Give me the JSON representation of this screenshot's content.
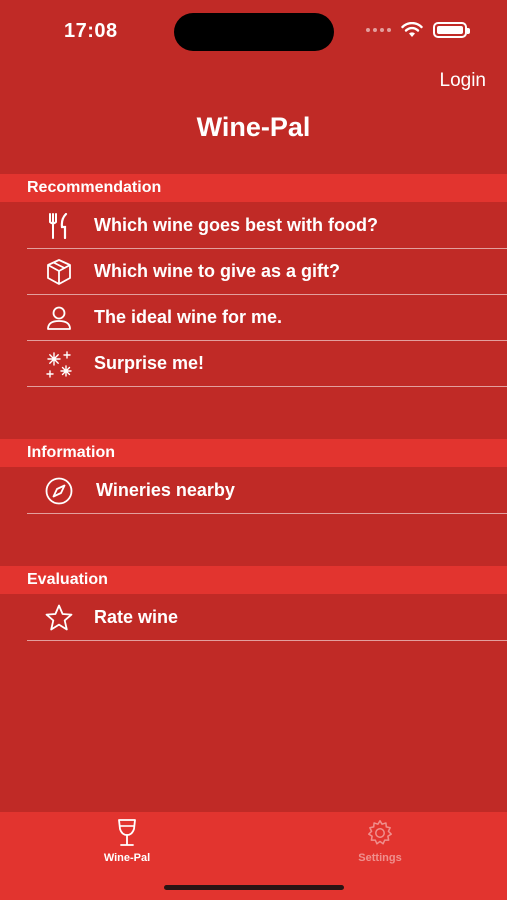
{
  "status_bar": {
    "time": "17:08"
  },
  "header": {
    "login_label": "Login",
    "title": "Wine-Pal"
  },
  "sections": {
    "recommendation": {
      "title": "Recommendation",
      "items": [
        {
          "label": "Which wine goes best with food?",
          "icon": "fork-knife-icon"
        },
        {
          "label": "Which wine to give as a gift?",
          "icon": "gift-box-icon"
        },
        {
          "label": "The ideal wine for me.",
          "icon": "person-icon"
        },
        {
          "label": "Surprise me!",
          "icon": "sparkler-icon"
        }
      ]
    },
    "information": {
      "title": "Information",
      "items": [
        {
          "label": "Wineries nearby",
          "icon": "compass-icon"
        }
      ]
    },
    "evaluation": {
      "title": "Evaluation",
      "items": [
        {
          "label": "Rate wine",
          "icon": "star-icon"
        }
      ]
    }
  },
  "tab_bar": {
    "tabs": [
      {
        "label": "Wine-Pal",
        "icon": "wine-glass-icon",
        "active": true
      },
      {
        "label": "Settings",
        "icon": "gear-icon",
        "active": false
      }
    ]
  },
  "colors": {
    "background": "#c02a26",
    "section_header": "#e2342f",
    "text": "#ffffff"
  }
}
